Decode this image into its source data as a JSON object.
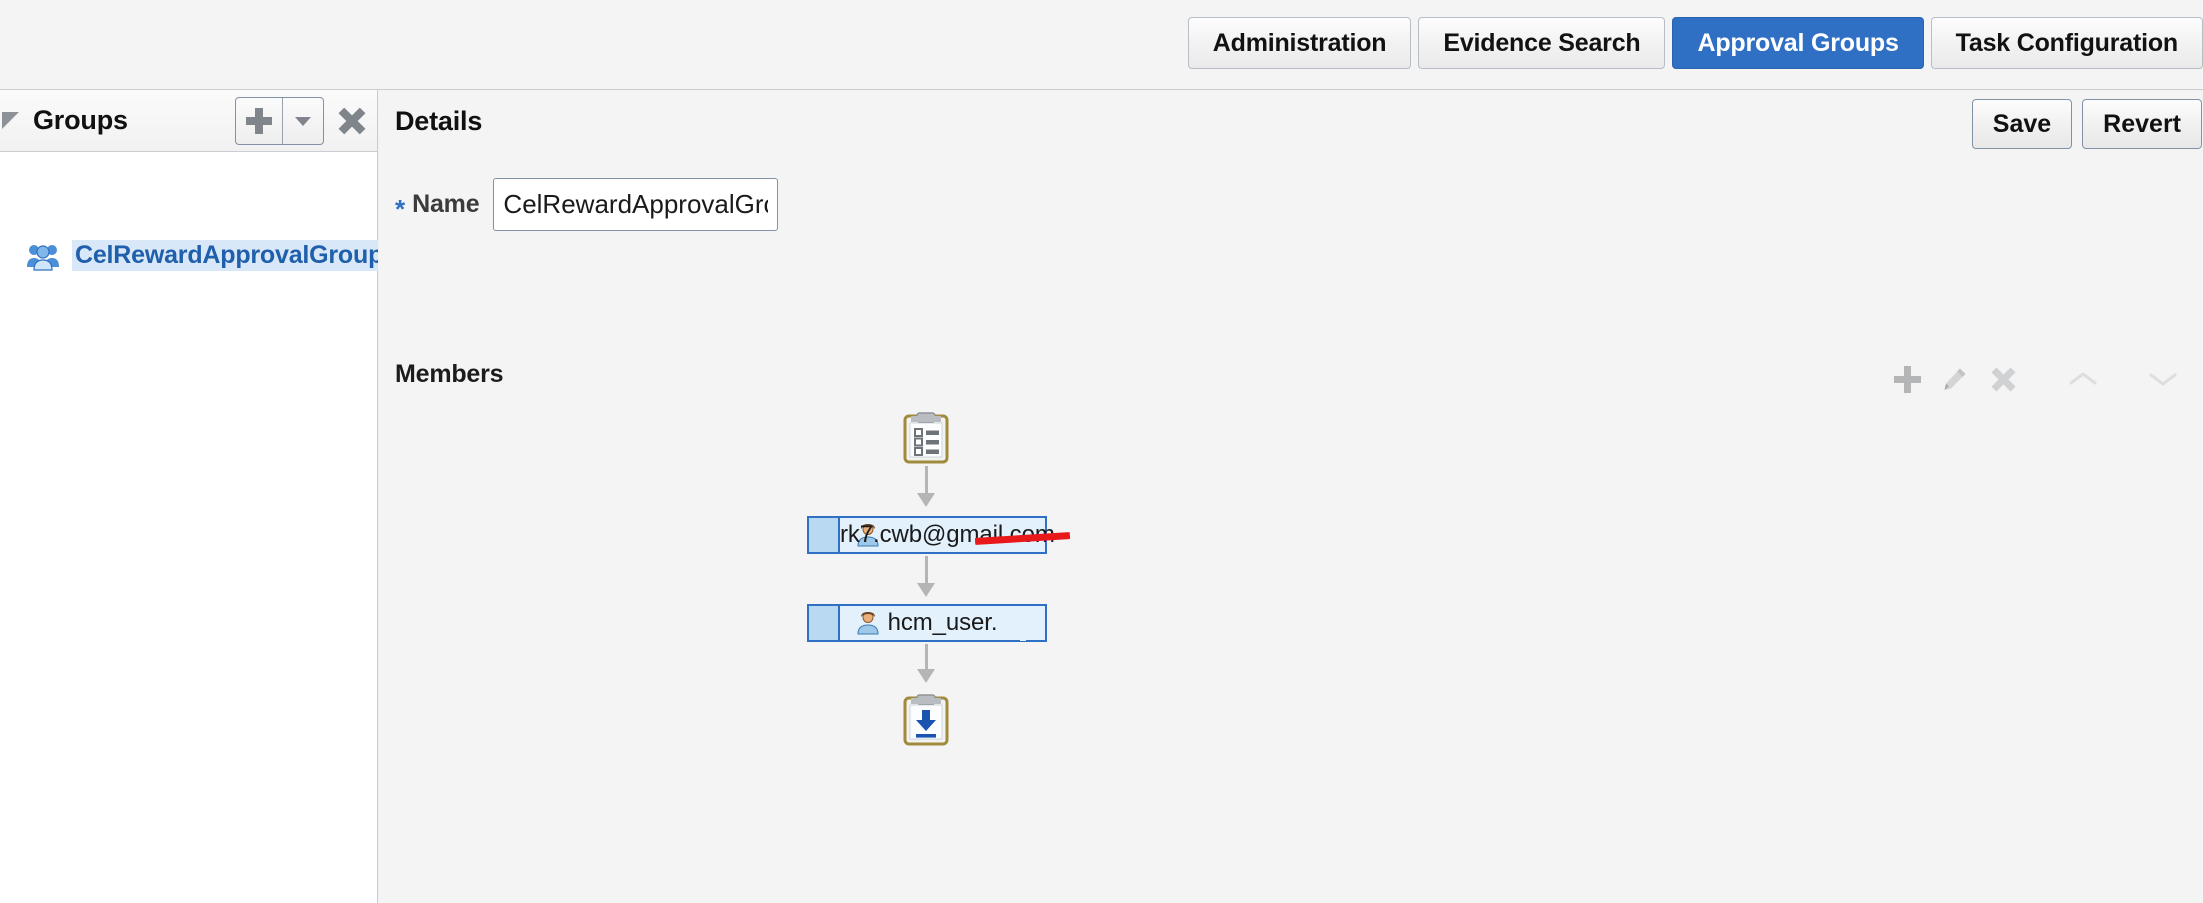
{
  "topbar": {
    "tabs": [
      {
        "label": "Administration",
        "active": false
      },
      {
        "label": "Evidence Search",
        "active": false
      },
      {
        "label": "Approval Groups",
        "active": true
      },
      {
        "label": "Task Configuration",
        "active": false
      }
    ],
    "active_tab_color": "#2f6fc4"
  },
  "sidebar": {
    "title": "Groups",
    "disclosure_icon": "triangle-collapse-icon",
    "toolbar": {
      "add_label": "add-group",
      "add_dropdown_label": "add-group-menu",
      "delete_label": "delete-group"
    },
    "items": [
      {
        "label": "CelRewardApprovalGroup",
        "icon": "group-users-icon",
        "selected": true
      }
    ]
  },
  "splitter": {
    "handle_icon": "collapse-left-icon"
  },
  "details": {
    "title": "Details",
    "save_label": "Save",
    "revert_label": "Revert",
    "name_required_marker": "*",
    "name_label": "Name",
    "name_value": "CelRewardApprovalGroup",
    "name_placeholder": "",
    "members_label": "Members",
    "members_toolbar": [
      {
        "name": "add-member-icon",
        "glyph": "plus",
        "enabled": true
      },
      {
        "name": "edit-member-icon",
        "glyph": "pencil",
        "enabled": false
      },
      {
        "name": "delete-member-icon",
        "glyph": "x",
        "enabled": false
      },
      {
        "name": "move-up-icon",
        "glyph": "chevron-up",
        "enabled": false
      },
      {
        "name": "move-down-icon",
        "glyph": "chevron-down",
        "enabled": false
      }
    ]
  },
  "flow": {
    "start_node_icon": "clipboard-list-icon",
    "end_node_icon": "clipboard-download-icon",
    "members": [
      {
        "label": "rk7.cwb@gmail.com",
        "icon": "user-icon",
        "redacted": true,
        "redaction_color": "#e8181b"
      },
      {
        "label": "hcm_user.",
        "icon": "user-icon",
        "redacted": false
      }
    ]
  }
}
